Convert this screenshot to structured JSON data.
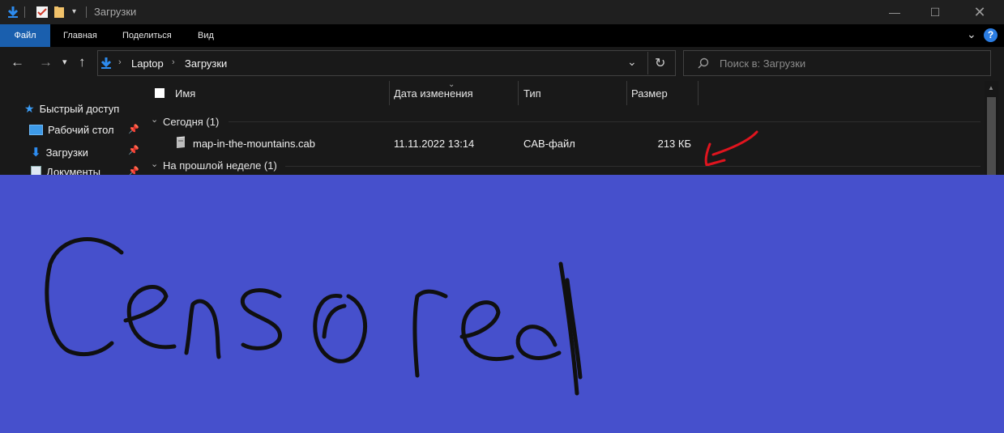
{
  "window": {
    "title": "Загрузки",
    "controls": [
      "minimize-icon",
      "maximize-icon",
      "close-icon"
    ]
  },
  "ribbon": {
    "tabs": [
      "Файл",
      "Главная",
      "Поделиться",
      "Вид"
    ],
    "help": "?"
  },
  "address": {
    "path": [
      "Laptop",
      "Загрузки"
    ],
    "search_placeholder": "Поиск в: Загрузки"
  },
  "nav": {
    "items": [
      {
        "label": "Быстрый доступ",
        "icon": "star-icon"
      },
      {
        "label": "Рабочий стол",
        "icon": "desktop-icon",
        "pinned": true
      },
      {
        "label": "Загрузки",
        "icon": "download-icon",
        "pinned": true
      },
      {
        "label": "Документы",
        "icon": "document-icon",
        "pinned": true
      }
    ]
  },
  "columns": [
    "Имя",
    "Дата изменения",
    "Тип",
    "Размер"
  ],
  "groups": [
    {
      "label": "Сегодня (1)",
      "files": [
        {
          "name": "map-in-the-mountains.cab",
          "date": "11.11.2022 13:14",
          "type": "CAB-файл",
          "size": "213 КБ"
        }
      ]
    },
    {
      "label": "На прошлой неделе (1)",
      "files": []
    }
  ],
  "annotations": {
    "arrow_color": "#e0141e",
    "overlay_color": "#4650cc",
    "overlay_text": "Censored"
  }
}
